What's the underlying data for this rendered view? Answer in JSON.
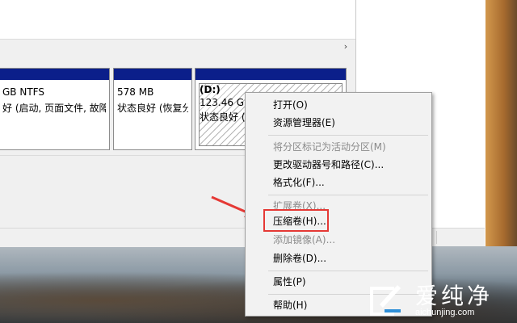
{
  "partitions": [
    {
      "size": "GB NTFS",
      "status": "好 (启动, 页面文件, 故障"
    },
    {
      "size": "578 MB",
      "status": "状态良好 (恢复分"
    },
    {
      "label": "(D:)",
      "size": "123.46 GB",
      "status": "状态良好 ("
    }
  ],
  "context_menu": {
    "items": [
      {
        "label": "打开(O)",
        "enabled": true
      },
      {
        "label": "资源管理器(E)",
        "enabled": true
      },
      {
        "label": "将分区标记为活动分区(M)",
        "enabled": false
      },
      {
        "label": "更改驱动器号和路径(C)...",
        "enabled": true
      },
      {
        "label": "格式化(F)...",
        "enabled": true
      },
      {
        "label": "扩展卷(X)...",
        "enabled": false
      },
      {
        "label": "压缩卷(H)...",
        "enabled": true,
        "highlighted": true
      },
      {
        "label": "添加镜像(A)...",
        "enabled": false
      },
      {
        "label": "删除卷(D)...",
        "enabled": true
      },
      {
        "label": "属性(P)",
        "enabled": true
      },
      {
        "label": "帮助(H)",
        "enabled": true
      }
    ]
  },
  "watermark": {
    "title": "爱纯净",
    "url": "aichunjing.com"
  },
  "colors": {
    "partition_bar": "#0b1f8a",
    "highlight": "#e53935"
  }
}
